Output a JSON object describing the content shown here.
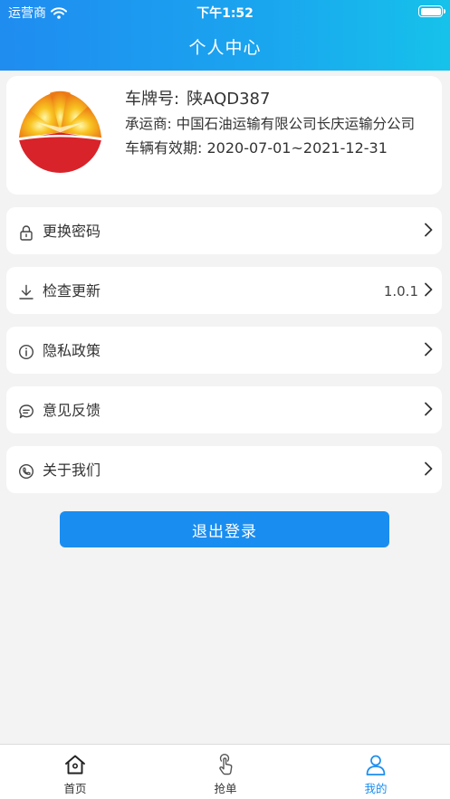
{
  "status_bar": {
    "carrier": "运营商",
    "time": "下午1:52"
  },
  "header": {
    "title": "个人中心"
  },
  "profile": {
    "plate_label": "车牌号:",
    "plate_value": "陕AQD387",
    "carrier_label": "承运商:",
    "carrier_value": "中国石油运输有限公司长庆运输分公司",
    "validity_label": "车辆有效期:",
    "validity_value": "2020-07-01~2021-12-31"
  },
  "menu": [
    {
      "label": "更换密码",
      "icon": "lock-icon"
    },
    {
      "label": "检查更新",
      "icon": "download-icon",
      "value": "1.0.1"
    },
    {
      "label": "隐私政策",
      "icon": "info-icon"
    },
    {
      "label": "意见反馈",
      "icon": "chat-icon"
    },
    {
      "label": "关于我们",
      "icon": "phone-icon"
    }
  ],
  "logout": {
    "label": "退出登录"
  },
  "tabs": [
    {
      "label": "首页",
      "icon": "home-icon",
      "active": false
    },
    {
      "label": "抢单",
      "icon": "tap-icon",
      "active": false
    },
    {
      "label": "我的",
      "icon": "user-icon",
      "active": true
    }
  ],
  "colors": {
    "primary": "#1a8df0",
    "header_end": "#16c2ea",
    "logo_red": "#d8232a",
    "logo_yellow": "#f4b81c",
    "background": "#f3f3f3"
  }
}
